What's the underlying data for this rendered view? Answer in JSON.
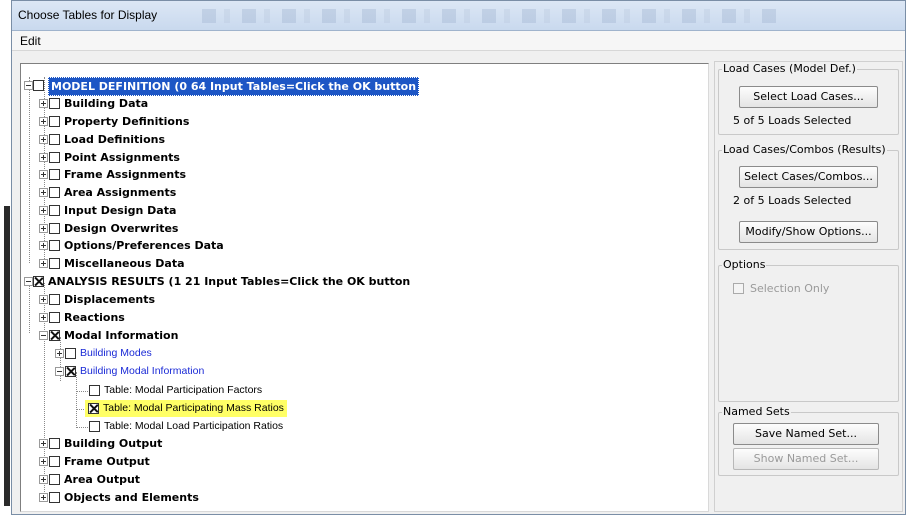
{
  "window": {
    "title": "Choose Tables for Display"
  },
  "menu": {
    "items": [
      "Edit"
    ]
  },
  "tree": {
    "rows": [
      {
        "label": "MODEL DEFINITION  (0  64 Input Tables=Click the OK button",
        "checked": false,
        "expander": "minus",
        "selected": true
      },
      {
        "label": "Building Data",
        "checked": false,
        "expander": "plus"
      },
      {
        "label": "Property Definitions",
        "checked": false,
        "expander": "plus"
      },
      {
        "label": "Load Definitions",
        "checked": false,
        "expander": "plus"
      },
      {
        "label": "Point Assignments",
        "checked": false,
        "expander": "plus"
      },
      {
        "label": "Frame Assignments",
        "checked": false,
        "expander": "plus"
      },
      {
        "label": "Area Assignments",
        "checked": false,
        "expander": "plus"
      },
      {
        "label": "Input Design Data",
        "checked": false,
        "expander": "plus"
      },
      {
        "label": "Design Overwrites",
        "checked": false,
        "expander": "plus"
      },
      {
        "label": "Options/Preferences Data",
        "checked": false,
        "expander": "plus"
      },
      {
        "label": "Miscellaneous Data",
        "checked": false,
        "expander": "plus"
      },
      {
        "label": "ANALYSIS RESULTS  (1  21 Input Tables=Click the OK button",
        "checked": true,
        "expander": "minus"
      },
      {
        "label": "Displacements",
        "checked": false,
        "expander": "plus"
      },
      {
        "label": "Reactions",
        "checked": false,
        "expander": "plus"
      },
      {
        "label": "Modal Information",
        "checked": true,
        "expander": "minus"
      },
      {
        "label": "Building Modes",
        "checked": false,
        "expander": "plus"
      },
      {
        "label": "Building Modal Information",
        "checked": true,
        "expander": "minus"
      },
      {
        "label": "Table:  Modal Participation Factors",
        "checked": false
      },
      {
        "label": "Table:  Modal Participating Mass Ratios",
        "checked": true,
        "highlight": true
      },
      {
        "label": "Table:  Modal Load Participation Ratios",
        "checked": false
      },
      {
        "label": "Building Output",
        "checked": false,
        "expander": "plus"
      },
      {
        "label": "Frame Output",
        "checked": false,
        "expander": "plus"
      },
      {
        "label": "Area Output",
        "checked": false,
        "expander": "plus"
      },
      {
        "label": "Objects and Elements",
        "checked": false,
        "expander": "plus"
      }
    ]
  },
  "side": {
    "load_cases_model": {
      "legend": "Load Cases (Model Def.)",
      "button": "Select Load Cases...",
      "status": "5  of  5  Loads Selected"
    },
    "load_cases_results": {
      "legend": "Load Cases/Combos (Results)",
      "button": "Select Cases/Combos...",
      "status": "2  of  5  Loads Selected",
      "options_button": "Modify/Show Options..."
    },
    "options": {
      "legend": "Options",
      "selection_only": "Selection Only",
      "selection_only_checked": false
    },
    "named_sets": {
      "legend": "Named Sets",
      "save_button": "Save Named Set...",
      "show_button": "Show Named Set..."
    }
  }
}
